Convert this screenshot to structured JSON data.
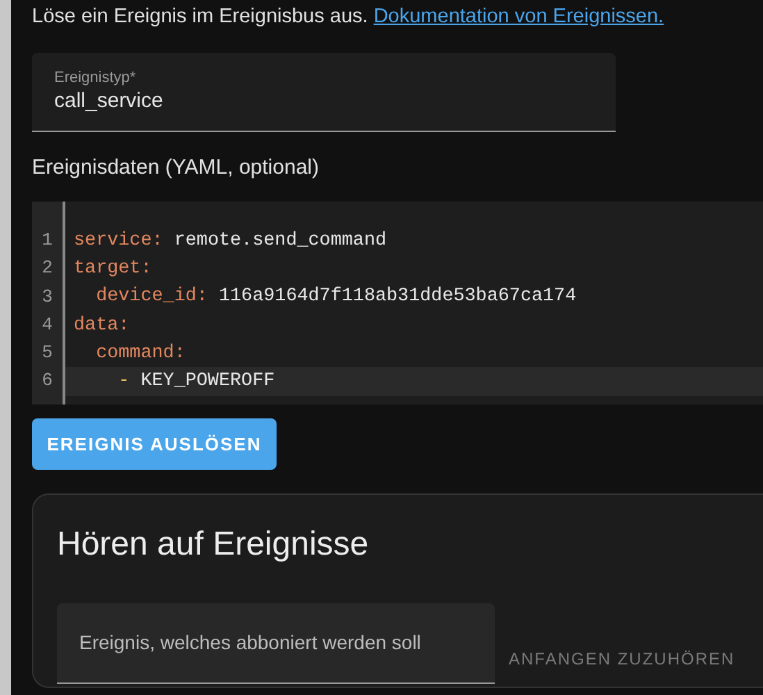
{
  "intro": {
    "text": "Löse ein Ereignis im Ereignisbus aus.",
    "link": "Dokumentation von Ereignissen."
  },
  "event_type": {
    "label": "Ereignistyp*",
    "value": "call_service"
  },
  "event_data": {
    "label": "Ereignisdaten (YAML, optional)",
    "lines": [
      {
        "number": "1",
        "active": false,
        "tokens": [
          {
            "kind": "key",
            "text": "service"
          },
          {
            "kind": "punct",
            "text": ":"
          },
          {
            "kind": "value",
            "text": " remote.send_command"
          }
        ]
      },
      {
        "number": "2",
        "active": false,
        "tokens": [
          {
            "kind": "key",
            "text": "target"
          },
          {
            "kind": "punct",
            "text": ":"
          }
        ]
      },
      {
        "number": "3",
        "active": false,
        "tokens": [
          {
            "kind": "key",
            "text": "  device_id"
          },
          {
            "kind": "punct",
            "text": ":"
          },
          {
            "kind": "value",
            "text": " 116a9164d7f118ab31dde53ba67ca174"
          }
        ]
      },
      {
        "number": "4",
        "active": false,
        "tokens": [
          {
            "kind": "key",
            "text": "data"
          },
          {
            "kind": "punct",
            "text": ":"
          }
        ]
      },
      {
        "number": "5",
        "active": false,
        "tokens": [
          {
            "kind": "key",
            "text": "  command"
          },
          {
            "kind": "punct",
            "text": ":"
          }
        ]
      },
      {
        "number": "6",
        "active": true,
        "tokens": [
          {
            "kind": "dash",
            "text": "    -"
          },
          {
            "kind": "value",
            "text": " KEY_POWEROFF"
          }
        ]
      }
    ]
  },
  "fire_button": {
    "label": "EREIGNIS AUSLÖSEN",
    "disabled": false
  },
  "listen_card": {
    "title": "Hören auf Ereignisse",
    "field": {
      "placeholder": "Ereignis, welches abboniert werden soll"
    },
    "button": {
      "label": "ANFANGEN ZUZUHÖREN",
      "disabled": true
    }
  }
}
